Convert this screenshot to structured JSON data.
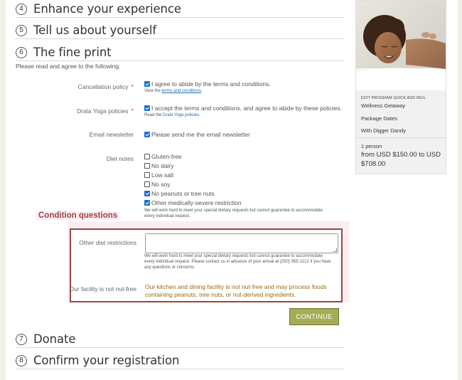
{
  "steps": {
    "s4": {
      "num": "4",
      "title": "Enhance your experience"
    },
    "s5": {
      "num": "5",
      "title": "Tell us about yourself"
    },
    "s6": {
      "num": "6",
      "title": "The fine print"
    },
    "s7": {
      "num": "7",
      "title": "Donate"
    },
    "s8": {
      "num": "8",
      "title": "Confirm your registration"
    }
  },
  "intro": "Please read and agree to the following.",
  "fields": {
    "cancellation": {
      "label": "Cancellation policy",
      "required_mark": "*",
      "option": "I agree to abide by the terms and conditions.",
      "help_prefix": "View the ",
      "help_link": "terms and conditions",
      "help_suffix": ".",
      "checked": true
    },
    "yoga": {
      "label": "Drala Yoga policies",
      "required_mark": "*",
      "option": "I accept the terms and conditions, and agree to abide by these policies.",
      "help_prefix": "Read the ",
      "help_link": "Drala Yoga policies",
      "help_suffix": ".",
      "checked": true
    },
    "newsletter": {
      "label": "Email newsletter",
      "option": "Please send me the email newsletter",
      "checked": true
    },
    "diet": {
      "label": "Diet notes",
      "options": [
        {
          "label": "Gluten-free",
          "checked": false
        },
        {
          "label": "No dairy",
          "checked": false
        },
        {
          "label": "Low salt",
          "checked": false
        },
        {
          "label": "No soy",
          "checked": false
        },
        {
          "label": "No peanuts or tree nuts",
          "checked": true
        },
        {
          "label": "Other medically-severe restriction",
          "checked": true
        }
      ],
      "help_line1": "We will work hard to meet your special dietary requests but cannot guarantee to accommodate",
      "help_line2": "every individual request."
    }
  },
  "condition": {
    "title": "Condition questions",
    "other_label": "Other diet restrictions",
    "other_value": "",
    "other_help_line1": "We will work hard to meet your special dietary requests but cannot guarantee to accommodate",
    "other_help_line2": "every individual request. Please contact us in advance of your arrival at (250) 555-1212 if you have",
    "other_help_line3": "any questions or concerns.",
    "facility_label": "Our facility is not nut-free",
    "facility_text": "Our kitchen and dining facility is not nut-free and may process foods containing peanuts, tree nuts, or nut-derived ingredients."
  },
  "continue_label": "CONTINUE",
  "sidebar": {
    "edit_link": "EDIT PROGRAM QUICK ADD REG.",
    "program": "Wellness Getaway",
    "dates": "Package Dates",
    "teacher": "With Digger Dandy",
    "persons": "1 person",
    "price_line1": "from USD $150.00 to USD",
    "price_line2": "$708.00"
  },
  "colors": {
    "accent_button": "#a4ad55",
    "condition_border": "#9b4545",
    "condition_title": "#a0404a",
    "warning_text": "#9a6a10",
    "link": "#1e6fb8",
    "checkbox": "#1f6fd1"
  }
}
